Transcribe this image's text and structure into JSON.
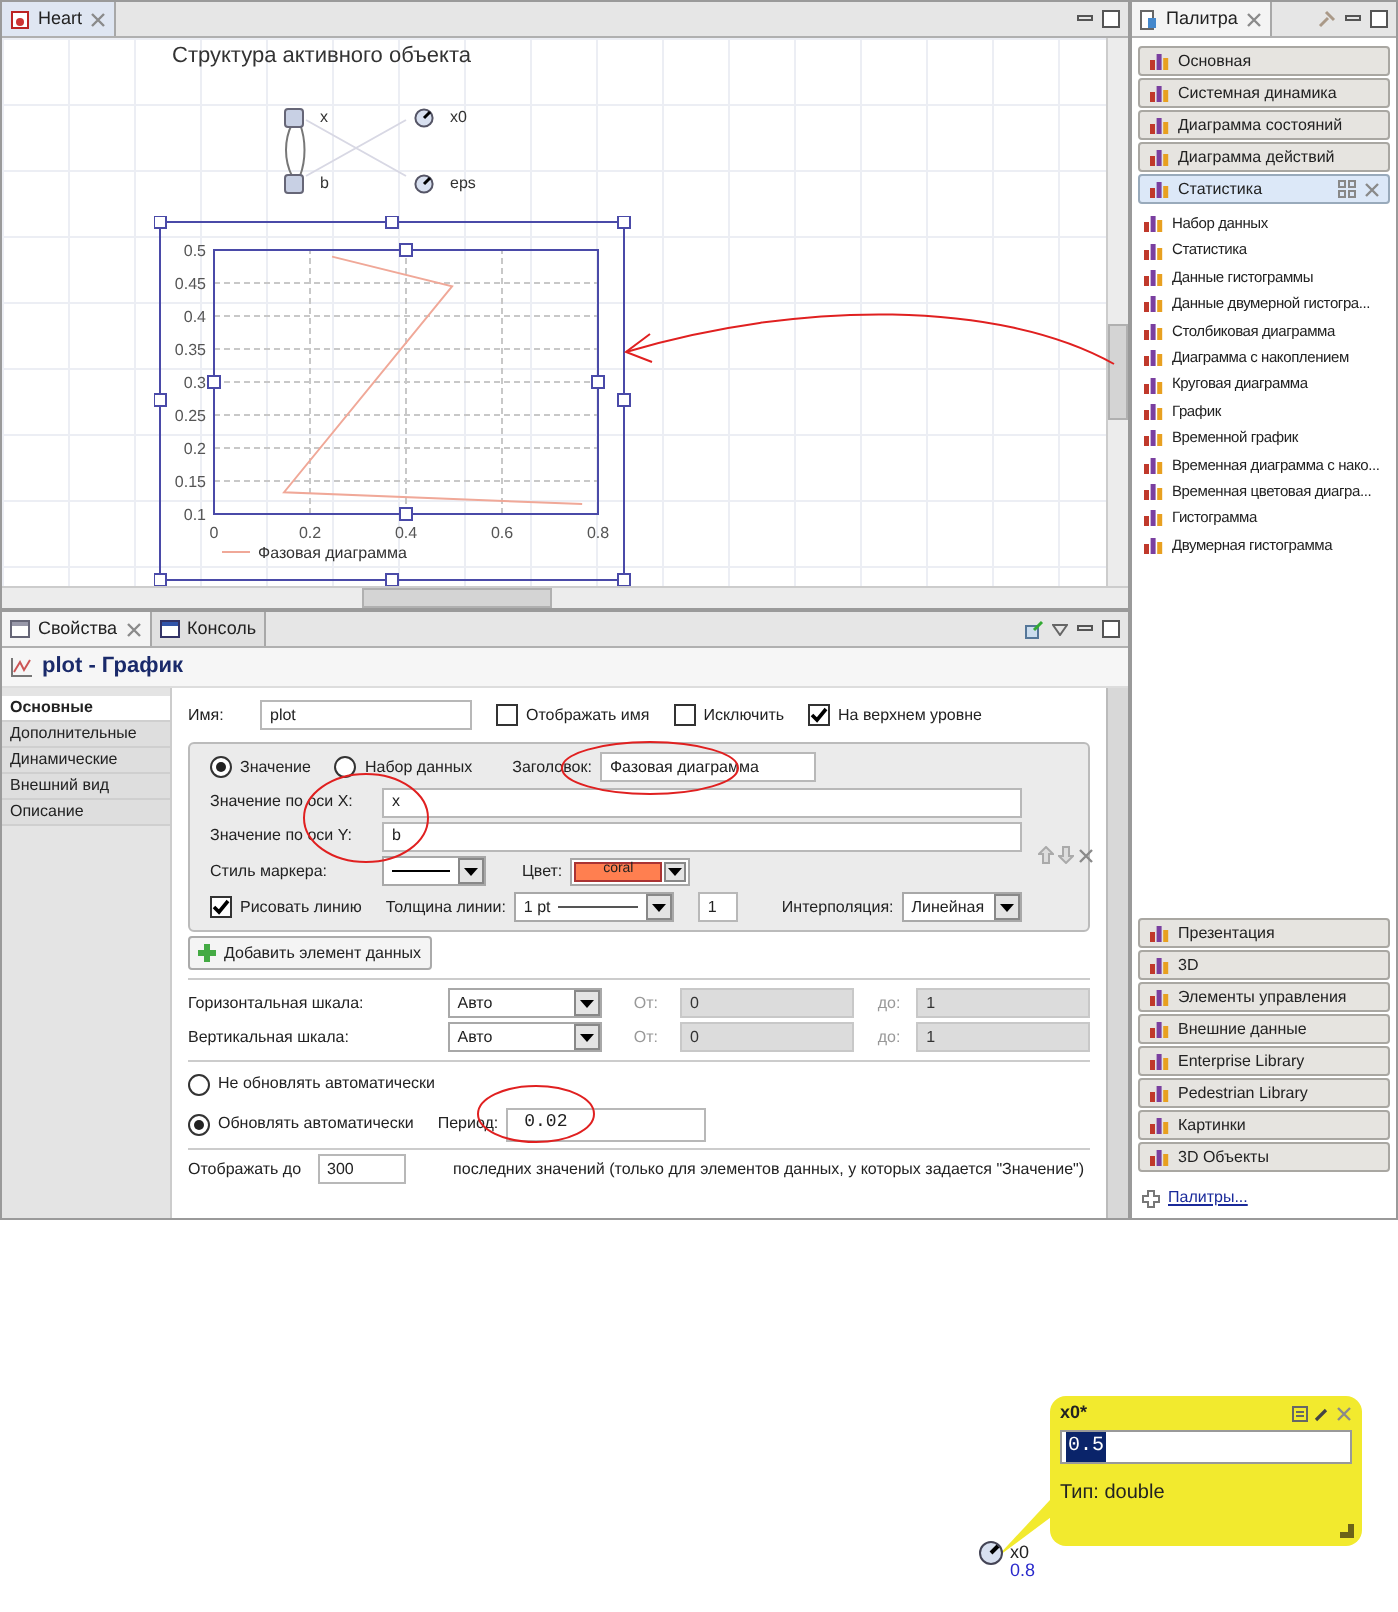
{
  "editor": {
    "tab": {
      "title": "Heart"
    },
    "canvas_title": "Структура активного объекта",
    "nodes": [
      {
        "kind": "variable",
        "label": "x"
      },
      {
        "kind": "variable",
        "label": "b"
      },
      {
        "kind": "parameter",
        "label": "x0"
      },
      {
        "kind": "parameter",
        "label": "eps"
      }
    ],
    "chart": {
      "chart_data": {
        "type": "line",
        "grid": true,
        "x": [
          0.246,
          0.496,
          0.146,
          0.767
        ],
        "xlim": [
          0,
          0.8
        ],
        "ylim": [
          0.1,
          0.5
        ],
        "xticks": [
          0,
          0.2,
          0.4,
          0.6,
          0.8
        ],
        "yticks": [
          0.1,
          0.15,
          0.2,
          0.25,
          0.3,
          0.35,
          0.4,
          0.45,
          0.5
        ],
        "series": [
          {
            "name": "Фазовая диаграмма",
            "color": "#f0a898",
            "values": [
              0.49,
              0.445,
              0.133,
              0.115
            ]
          }
        ]
      }
    }
  },
  "palette": {
    "tab": {
      "title": "Палитра"
    },
    "sections": [
      {
        "label": "Основная",
        "expanded": false
      },
      {
        "label": "Системная динамика",
        "expanded": false
      },
      {
        "label": "Диаграмма состояний",
        "expanded": false
      },
      {
        "label": "Диаграмма действий",
        "expanded": false
      },
      {
        "label": "Статистика",
        "expanded": true,
        "items": [
          {
            "label": "Набор данных"
          },
          {
            "label": "Статистика"
          },
          {
            "label": "Данные гистограммы"
          },
          {
            "label": "Данные двумерной гистогра..."
          },
          {
            "label": "Столбиковая диаграмма"
          },
          {
            "label": "Диаграмма с накоплением"
          },
          {
            "label": "Круговая диаграмма"
          },
          {
            "label": "График"
          },
          {
            "label": "Временной график"
          },
          {
            "label": "Временная диаграмма с нако..."
          },
          {
            "label": "Временная цветовая диагра..."
          },
          {
            "label": "Гистограмма"
          },
          {
            "label": "Двумерная гистограмма"
          }
        ]
      },
      {
        "label": "Презентация",
        "expanded": false
      },
      {
        "label": "3D",
        "expanded": false
      },
      {
        "label": "Элементы управления",
        "expanded": false
      },
      {
        "label": "Внешние данные",
        "expanded": false
      },
      {
        "label": "Enterprise Library",
        "expanded": false
      },
      {
        "label": "Pedestrian Library",
        "expanded": false
      },
      {
        "label": "Картинки",
        "expanded": false
      },
      {
        "label": "3D Объекты",
        "expanded": false
      }
    ],
    "link": "Палитры..."
  },
  "properties": {
    "tabs": [
      {
        "label": "Свойства",
        "selected": true
      },
      {
        "label": "Консоль",
        "selected": false
      }
    ],
    "title": "plot - График",
    "side_tabs": [
      {
        "label": "Основные",
        "selected": true
      },
      {
        "label": "Дополнительные",
        "selected": false
      },
      {
        "label": "Динамические",
        "selected": false
      },
      {
        "label": "Внешний вид",
        "selected": false
      },
      {
        "label": "Описание",
        "selected": false
      }
    ],
    "name": {
      "label": "Имя:",
      "value": "plot"
    },
    "flags": [
      {
        "label": "Отображать имя",
        "checked": false
      },
      {
        "label": "Исключить",
        "checked": false
      },
      {
        "label": "На верхнем уровне",
        "checked": true
      }
    ],
    "data_item": {
      "sources": [
        {
          "label": "Значение",
          "selected": true
        },
        {
          "label": "Набор данных",
          "selected": false
        }
      ],
      "title_label": "Заголовок:",
      "title_value": "Фазовая диаграмма",
      "x_label": "Значение по оси X:",
      "x_value": "x",
      "y_label": "Значение по оси Y:",
      "y_value": "b",
      "marker_label": "Стиль маркера:",
      "color_label": "Цвет:",
      "color_value": "coral",
      "draw_line": {
        "label": "Рисовать линию",
        "checked": true
      },
      "width_label": "Толщина линии:",
      "width_value": "1 pt",
      "width_number": "1",
      "interp_label": "Интерполяция:",
      "interp_value": "Линейная"
    },
    "add_button": "Добавить элемент данных",
    "scales": [
      {
        "label": "Горизонтальная шкала:",
        "value": "Авто",
        "from_label": "От:",
        "from": "0",
        "to_label": "до:",
        "to": "1",
        "disabled": true
      },
      {
        "label": "Вертикальная шкала:",
        "value": "Авто",
        "from_label": "От:",
        "from": "0",
        "to_label": "до:",
        "to": "1",
        "disabled": true
      }
    ],
    "update": [
      {
        "label": "Не обновлять автоматически",
        "selected": false
      },
      {
        "label": "Обновлять автоматически",
        "selected": true
      }
    ],
    "period_label": "Период:",
    "period_value": "0.02",
    "show_label": "Отображать до",
    "show_value": "300",
    "show_suffix": "последних значений (только для элементов данных, у которых задается \"Значение\")"
  },
  "popup": {
    "title": "x0*",
    "value": "0.5",
    "type_text": "Тип: double",
    "node": {
      "label": "x0",
      "value": "0.8"
    }
  }
}
